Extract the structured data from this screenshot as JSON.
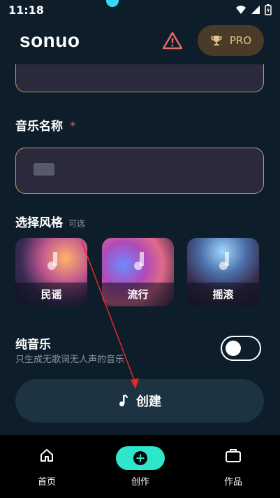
{
  "status_bar": {
    "time": "11:18"
  },
  "header": {
    "app_title": "sonuo",
    "pro_label": "PRO"
  },
  "form": {
    "music_name_label": "音乐名称",
    "required_mark": "*",
    "name_input_value": "",
    "style_label": "选择风格",
    "style_optional": "可选",
    "styles": [
      {
        "label": "民谣"
      },
      {
        "label": "流行"
      },
      {
        "label": "摇滚"
      }
    ],
    "pure_music_title": "纯音乐",
    "pure_music_desc": "只生成无歌词无人声的音乐",
    "pure_music_enabled": false,
    "create_label": "创建"
  },
  "bottom_nav": {
    "items": [
      {
        "label": "首页"
      },
      {
        "label": "创作"
      },
      {
        "label": "作品"
      }
    ],
    "active_index": 1
  },
  "colors": {
    "background": "#0d1e2a",
    "accent": "#2ee6cc",
    "field_border": "#b89a6c",
    "pro_bg": "#4a3b28",
    "warning": "#e06b6b"
  }
}
